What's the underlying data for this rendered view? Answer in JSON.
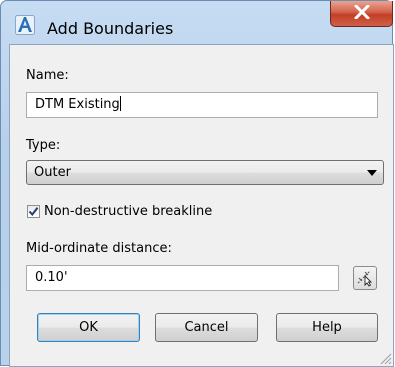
{
  "window": {
    "title": "Add Boundaries",
    "app_icon": "autocad-a-icon",
    "close_icon": "close-x-icon"
  },
  "form": {
    "name_label": "Name:",
    "name_value": "DTM Existing",
    "type_label": "Type:",
    "type_value": "Outer",
    "breakline_label": "Non-destructive breakline",
    "breakline_checked": true,
    "mid_ordinate_label": "Mid-ordinate distance:",
    "mid_ordinate_value": "0.10'",
    "pick_icon": "pick-distance-icon"
  },
  "buttons": {
    "ok": "OK",
    "cancel": "Cancel",
    "help": "Help"
  },
  "colors": {
    "title_bar": "#c6dcf3",
    "close_button": "#c94a32",
    "accent_icon": "#2a6fb6"
  }
}
